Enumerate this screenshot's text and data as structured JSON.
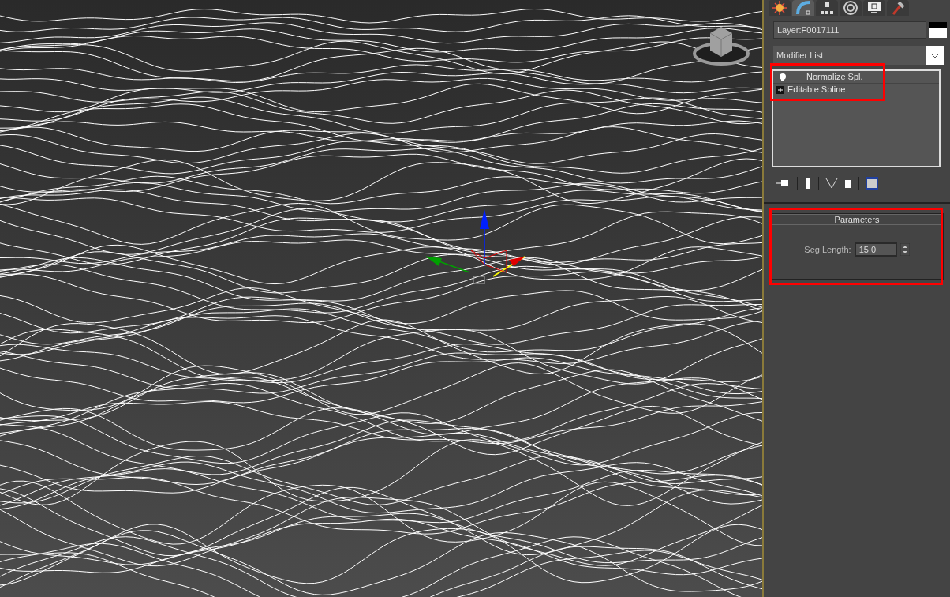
{
  "command_panel": {
    "tabs": [
      {
        "kind": "create",
        "selected": false
      },
      {
        "kind": "modify",
        "selected": true
      },
      {
        "kind": "hierarchy",
        "selected": false
      },
      {
        "kind": "motion",
        "selected": false
      },
      {
        "kind": "display",
        "selected": false
      },
      {
        "kind": "utilities",
        "selected": false
      }
    ],
    "object_name": "Layer:F0017111",
    "modifier_list": "Modifier List",
    "stack": [
      {
        "kind": "modifier",
        "label": "Normalize Spl.",
        "selected": false
      },
      {
        "kind": "base",
        "label": "Editable Spline",
        "selected": false
      }
    ],
    "rollout": {
      "title": "Parameters",
      "fields": [
        {
          "label": "Seg Length:",
          "value": "15.0"
        }
      ]
    }
  }
}
